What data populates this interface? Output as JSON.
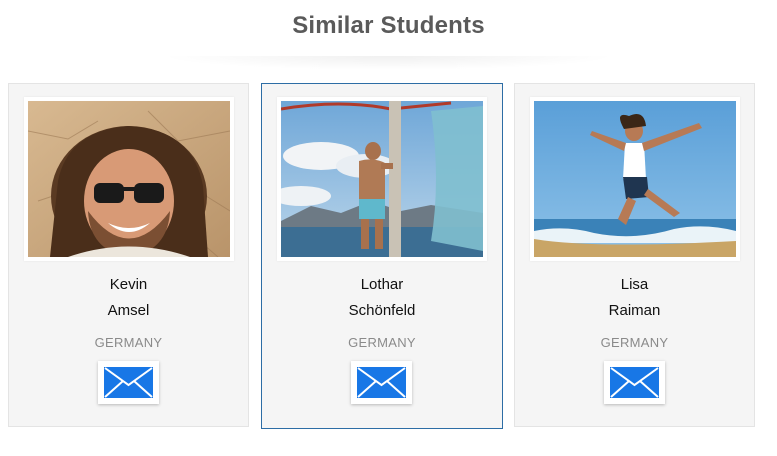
{
  "section": {
    "title": "Similar Students"
  },
  "students": [
    {
      "first_name": "Kevin",
      "last_name": "Amsel",
      "country": "GERMANY",
      "photo_icon": "portrait-photo",
      "contact_icon": "envelope-icon",
      "selected": false
    },
    {
      "first_name": "Lothar",
      "last_name": "Schönfeld",
      "country": "GERMANY",
      "photo_icon": "beach-photo",
      "contact_icon": "envelope-icon",
      "selected": true
    },
    {
      "first_name": "Lisa",
      "last_name": "Raiman",
      "country": "GERMANY",
      "photo_icon": "beach-jump-photo",
      "contact_icon": "envelope-icon",
      "selected": false
    }
  ],
  "colors": {
    "accent_border": "#2d6da5",
    "envelope_blue": "#1877e6",
    "heading": "#5a5a5a",
    "country": "#8a8a8a",
    "card_bg": "#f5f5f5"
  }
}
